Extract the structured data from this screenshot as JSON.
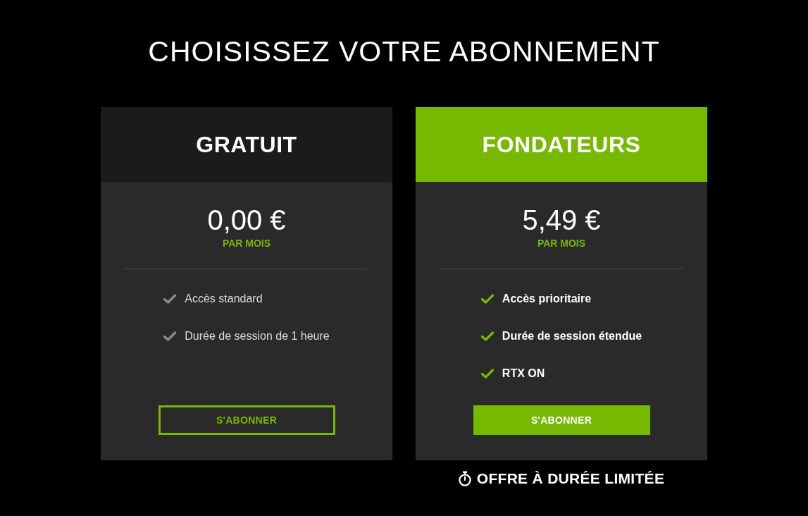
{
  "title": "CHOISISSEZ VOTRE ABONNEMENT",
  "plans": [
    {
      "name": "GRATUIT",
      "featured": false,
      "price": "0,00 €",
      "period": "PAR MOIS",
      "features": [
        "Accès standard",
        "Durée de session de 1 heure"
      ],
      "button": "S'ABONNER"
    },
    {
      "name": "FONDATEURS",
      "featured": true,
      "price": "5,49 €",
      "period": "PAR MOIS",
      "features": [
        "Accès prioritaire",
        "Durée de session étendue",
        "RTX ON"
      ],
      "button": "S'ABONNER",
      "note": "OFFRE À DURÉE LIMITÉE"
    }
  ]
}
